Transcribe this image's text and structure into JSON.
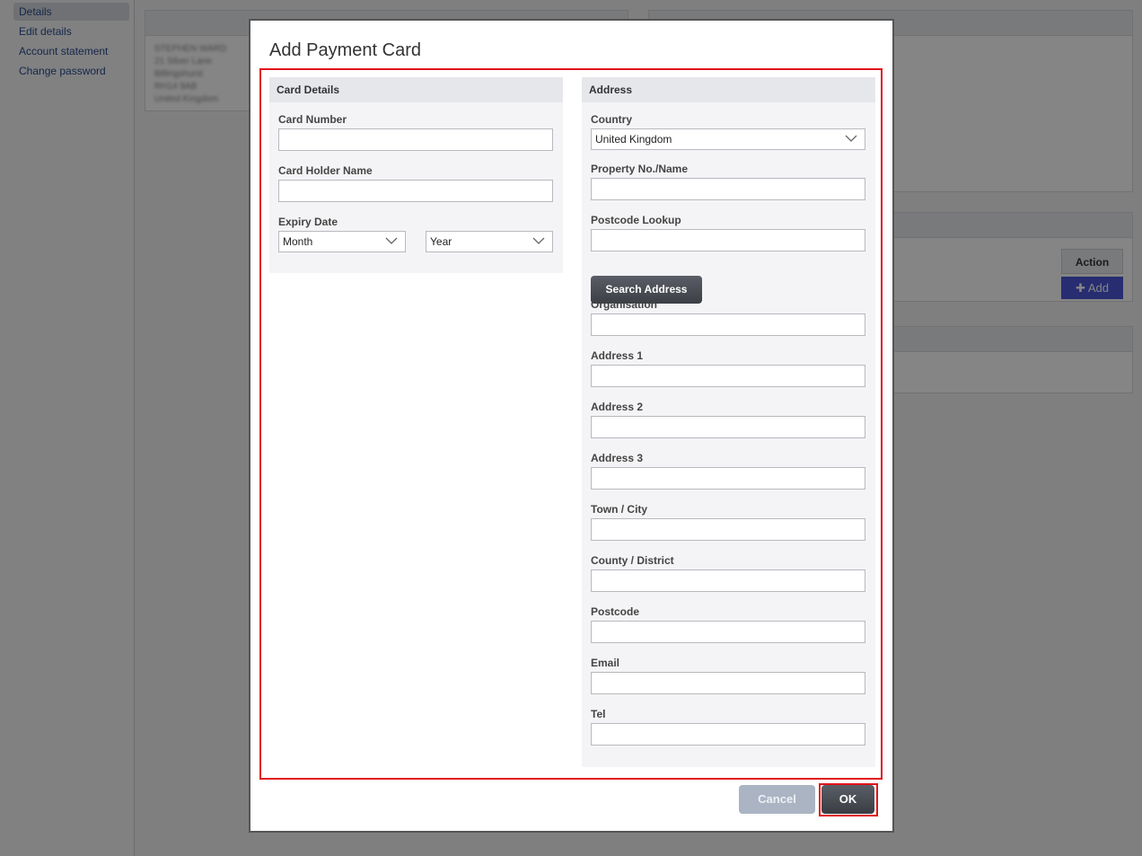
{
  "sidebar": {
    "items": [
      {
        "label": "Details",
        "active": true
      },
      {
        "label": "Edit details"
      },
      {
        "label": "Account statement"
      },
      {
        "label": "Change password"
      }
    ]
  },
  "background": {
    "address_lines": [
      "STEPHEN WARD",
      "21 Silver Lane",
      "Billingshurst",
      "RH14 9AB",
      "United Kingdom"
    ],
    "action_header": "Action",
    "add_button": "Add"
  },
  "modal": {
    "title": "Add Payment Card",
    "card_details": {
      "header": "Card Details",
      "card_number_label": "Card Number",
      "card_holder_label": "Card Holder Name",
      "expiry_label": "Expiry Date",
      "month_value": "Month",
      "year_value": "Year"
    },
    "address": {
      "header": "Address",
      "country_label": "Country",
      "country_value": "United Kingdom",
      "property_label": "Property No./Name",
      "postcode_lookup_label": "Postcode Lookup",
      "search_button": "Search Address",
      "organisation_label": "Organisation",
      "address1_label": "Address 1",
      "address2_label": "Address 2",
      "address3_label": "Address 3",
      "town_label": "Town / City",
      "county_label": "County / District",
      "postcode_label": "Postcode",
      "email_label": "Email",
      "tel_label": "Tel"
    },
    "cancel_button": "Cancel",
    "ok_button": "OK"
  },
  "colors": {
    "highlight": "#e0141a",
    "link": "#2a4d8f",
    "primary_button": "#44474d",
    "add_button": "#4b57d6"
  }
}
